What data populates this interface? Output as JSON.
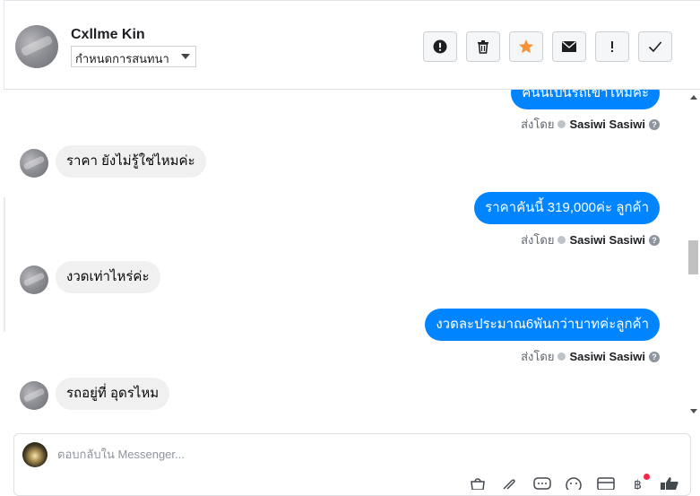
{
  "header": {
    "contact_name": "Cxllme Kin",
    "status_select_value": "กำหนดการสนทนา",
    "actions": [
      {
        "icon": "alert-circle-icon"
      },
      {
        "icon": "trash-icon"
      },
      {
        "icon": "star-icon",
        "color": "#f7923b"
      },
      {
        "icon": "envelope-icon"
      },
      {
        "icon": "exclamation-icon"
      },
      {
        "icon": "check-icon"
      }
    ]
  },
  "messages": [
    {
      "direction": "out",
      "text": "คันนี้เป็นรถเข้าไหมคะ"
    },
    {
      "direction": "in",
      "text": "ราคา ยังไม่รู้ใช่ไหมค่ะ"
    },
    {
      "direction": "out",
      "text": "ราคาคันนี้ 319,000ค่ะ ลูกค้า"
    },
    {
      "direction": "in",
      "text": "งวดเท่าไหร่ค่ะ"
    },
    {
      "direction": "out",
      "text": "งวดละประมาณ6พันกว่าบาทค่ะลูกค้า"
    },
    {
      "direction": "in",
      "text": "รถอยู่ที่ อุดรไหม"
    }
  ],
  "sent_by": {
    "label": "ส่งโดย",
    "sender": "Sasiwi Sasiwi",
    "help": "?"
  },
  "composer": {
    "placeholder": "ตอบกลับใน Messenger...",
    "tools": [
      "bag-icon",
      "paperclip-icon",
      "chat-bubble-icon",
      "emoji-icon",
      "store-icon",
      "baht-icon",
      "thumbs-up-icon"
    ]
  },
  "colors": {
    "outgoing_bubble": "#0084ff",
    "incoming_bubble": "#f0f0f0",
    "star": "#f7923b",
    "notification": "#f02849"
  }
}
